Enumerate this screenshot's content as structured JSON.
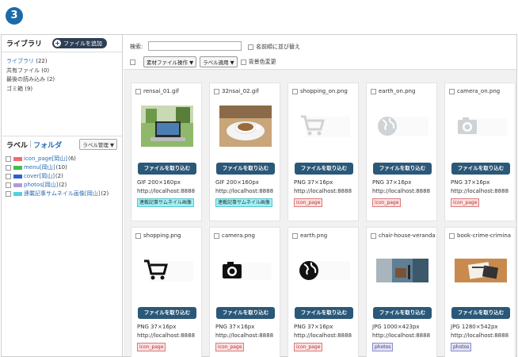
{
  "step_number": "3",
  "sidebar": {
    "title": "ライブラリ",
    "add_file_label": "ファイルを追加",
    "library_items": [
      {
        "label": "ライブラリ",
        "count": "(22)",
        "active": true
      },
      {
        "label": "共有ファイル",
        "count": "(0)"
      },
      {
        "label": "最後の読み込み",
        "count": "(2)"
      },
      {
        "label": "ゴミ箱",
        "count": "(9)"
      }
    ],
    "label_tab": "ラベル",
    "folder_tab": "フォルダ",
    "label_manage": "ラベル管理 ▼",
    "labels": [
      {
        "name": "icon_page[岡山]",
        "count": "(6)",
        "color": "#f26b6b"
      },
      {
        "name": "menu[岡山]",
        "count": "(10)",
        "color": "#3fbf4f"
      },
      {
        "name": "cover[岡山]",
        "count": "(2)",
        "color": "#2f5fd0"
      },
      {
        "name": "photos[岡山]",
        "count": "(2)",
        "color": "#b39bd6"
      },
      {
        "name": "連載記事サムネイル画像[岡山]",
        "count": "(2)",
        "color": "#4fd2e0"
      }
    ]
  },
  "toolbar": {
    "search_label": "検索:",
    "search_value": "",
    "sort_label": "名前順に並び替え",
    "material_ops": "素材ファイル操作 ▼",
    "label_apply": "ラベル適用 ▼",
    "bg_color": "背景色変更"
  },
  "files": [
    {
      "name": "rensai_01.gif",
      "type": "photo-laptop",
      "button": "ファイルを取り込む",
      "meta": "GIF 200×160px",
      "url": "http://localhost:8888",
      "tag": "連載記事サムネイル画像",
      "tag_style": "cyan"
    },
    {
      "name": "32nsai_02.gif",
      "type": "photo-cup",
      "button": "ファイルを取り込む",
      "meta": "GIF 200×160px",
      "url": "http://localhost:8888",
      "tag": "連載記事サムネイル画像",
      "tag_style": "cyan"
    },
    {
      "name": "shopping_on.png",
      "type": "cart-light",
      "button": "ファイルを取り込む",
      "meta": "PNG 37×16px",
      "url": "http://localhost:8888",
      "tag": "icon_page",
      "tag_style": "pink"
    },
    {
      "name": "earth_on.png",
      "type": "earth-light",
      "button": "ファイルを取り込む",
      "meta": "PNG 37×16px",
      "url": "http://localhost:8888",
      "tag": "icon_page",
      "tag_style": "pink"
    },
    {
      "name": "camera_on.png",
      "type": "camera-light",
      "button": "ファイルを取り込む",
      "meta": "PNG 37×16px",
      "url": "http://localhost:8888",
      "tag": "icon_page",
      "tag_style": "pink"
    },
    {
      "name": "shopping.png",
      "type": "cart-dark",
      "button": "ファイルを取り込む",
      "meta": "PNG 37×16px",
      "url": "http://localhost:8888",
      "tag": "icon_page",
      "tag_style": "pink"
    },
    {
      "name": "camera.png",
      "type": "camera-dark",
      "button": "ファイルを取り込む",
      "meta": "PNG 37×16px",
      "url": "http://localhost:8888",
      "tag": "icon_page",
      "tag_style": "pink"
    },
    {
      "name": "earth.png",
      "type": "earth-dark",
      "button": "ファイルを取り込む",
      "meta": "PNG 37×16px",
      "url": "http://localhost:8888",
      "tag": "icon_page",
      "tag_style": "pink"
    },
    {
      "name": "chair-house-veranda",
      "type": "photo-chair",
      "button": "ファイルを取り込む",
      "meta": "JPG 1000×423px",
      "url": "http://localhost:8888",
      "tag": "photos",
      "tag_style": "lilac"
    },
    {
      "name": "book-crime-crimina",
      "type": "photo-book",
      "button": "ファイルを取り込む",
      "meta": "JPG 1280×542px",
      "url": "http://localhost:8888",
      "tag": "photos",
      "tag_style": "lilac"
    }
  ]
}
